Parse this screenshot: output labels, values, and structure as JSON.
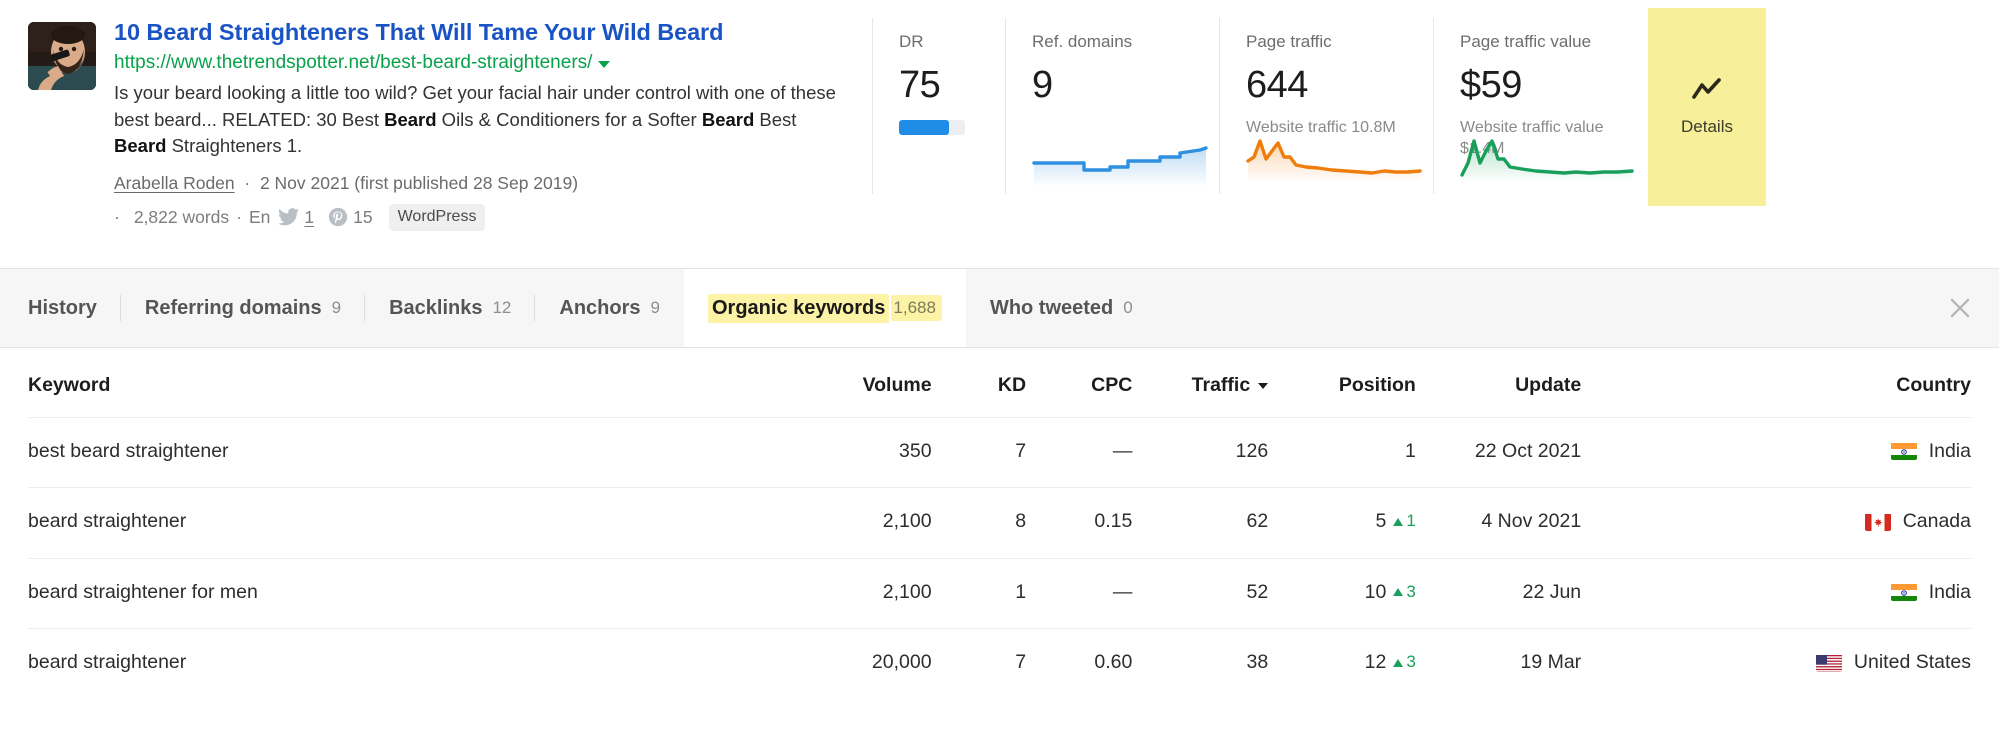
{
  "result": {
    "thumbnail_alt": "man-combing-beard-photo",
    "title": "10 Beard Straighteners That Will Tame Your Wild Beard",
    "url": "https://www.thetrendspotter.net/best-beard-straighteners/",
    "url_caret_icon": "chevron-down-icon",
    "description_parts": [
      {
        "t": "Is your beard looking a little too wild? Get your facial hair under control with one of these best beard... RELATED: 30 Best ",
        "b": false
      },
      {
        "t": "Beard",
        "b": true
      },
      {
        "t": " Oils & Conditioners for a Softer ",
        "b": false
      },
      {
        "t": "Beard",
        "b": true
      },
      {
        "t": " Best ",
        "b": false
      },
      {
        "t": "Beard",
        "b": true
      },
      {
        "t": " Straighteners 1.",
        "b": false
      }
    ],
    "author": "Arabella Roden",
    "date_line": "2 Nov 2021 (first published 28 Sep 2019)",
    "word_count": "2,822 words",
    "language": "En",
    "twitter_icon": "twitter-icon",
    "twitter_count": "1",
    "pinterest_icon": "pinterest-icon",
    "pinterest_count": "15",
    "cms_badge": "WordPress",
    "dot": "·"
  },
  "metrics": [
    {
      "key": "dr",
      "label": "DR",
      "value": "75",
      "bar_percent": 75,
      "bar_color": "#1f8ce8"
    },
    {
      "key": "ref_domains",
      "label": "Ref. domains",
      "value": "9",
      "sub": "",
      "spark_color": "#2f8fe0"
    },
    {
      "key": "page_traffic",
      "label": "Page traffic",
      "value": "644",
      "sub": "Website traffic 10.8M",
      "spark_color": "#f07d0b"
    },
    {
      "key": "page_traffic_value",
      "label": "Page traffic value",
      "value": "$59",
      "sub": "Website traffic value $1.4M",
      "spark_color": "#18a05a"
    }
  ],
  "details_panel": {
    "icon": "trend-chart-icon",
    "label": "Details",
    "bg": "#f7ef9a"
  },
  "tabs": {
    "items": [
      {
        "label": "History",
        "count": "",
        "active": false
      },
      {
        "label": "Referring domains",
        "count": "9",
        "active": false
      },
      {
        "label": "Backlinks",
        "count": "12",
        "active": false
      },
      {
        "label": "Anchors",
        "count": "9",
        "active": false
      },
      {
        "label": "Organic keywords",
        "count": "1,688",
        "active": true
      },
      {
        "label": "Who tweeted",
        "count": "0",
        "active": false
      }
    ],
    "close_icon": "close-icon"
  },
  "table": {
    "columns": [
      {
        "key": "keyword",
        "label": "Keyword",
        "align": "left"
      },
      {
        "key": "volume",
        "label": "Volume",
        "align": "right"
      },
      {
        "key": "kd",
        "label": "KD",
        "align": "right"
      },
      {
        "key": "cpc",
        "label": "CPC",
        "align": "right"
      },
      {
        "key": "traffic",
        "label": "Traffic",
        "align": "right",
        "sorted": true,
        "sort_dir": "desc"
      },
      {
        "key": "position",
        "label": "Position",
        "align": "left"
      },
      {
        "key": "update",
        "label": "Update",
        "align": "left"
      },
      {
        "key": "country",
        "label": "Country",
        "align": "left"
      }
    ],
    "rows": [
      {
        "keyword": "best beard straightener",
        "volume": "350",
        "kd": "7",
        "cpc": "—",
        "traffic": "126",
        "position": "1",
        "delta": "",
        "delta_dir": "",
        "update": "22 Oct 2021",
        "country": "India",
        "flag": "flag-in"
      },
      {
        "keyword": "beard straightener",
        "volume": "2,100",
        "kd": "8",
        "cpc": "0.15",
        "traffic": "62",
        "position": "5",
        "delta": "1",
        "delta_dir": "up",
        "update": "4 Nov 2021",
        "country": "Canada",
        "flag": "flag-ca"
      },
      {
        "keyword": "beard straightener for men",
        "volume": "2,100",
        "kd": "1",
        "cpc": "—",
        "traffic": "52",
        "position": "10",
        "delta": "3",
        "delta_dir": "up",
        "update": "22 Jun",
        "country": "India",
        "flag": "flag-in"
      },
      {
        "keyword": "beard straightener",
        "volume": "20,000",
        "kd": "7",
        "cpc": "0.60",
        "traffic": "38",
        "position": "12",
        "delta": "3",
        "delta_dir": "up",
        "update": "19 Mar",
        "country": "United States",
        "flag": "flag-us"
      }
    ]
  }
}
